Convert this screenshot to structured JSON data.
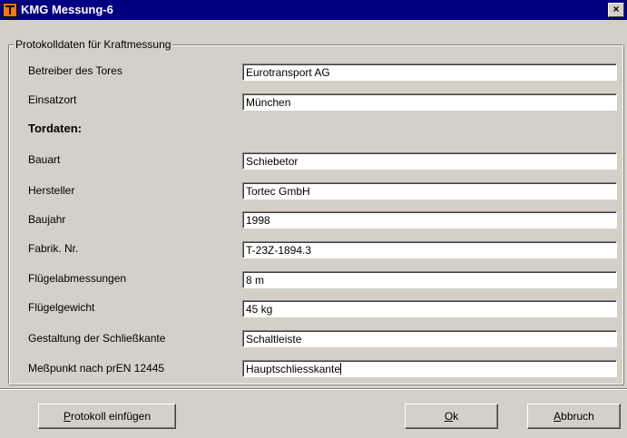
{
  "window": {
    "title": "KMG Messung-6",
    "close_glyph": "×",
    "icon": "app-icon"
  },
  "group": {
    "legend": "Protokolldaten für Kraftmessung",
    "section_heading": "Tordaten:"
  },
  "fields": [
    {
      "label": "Betreiber des Tores",
      "value": "Eurotransport AG"
    },
    {
      "label": "Einsatzort",
      "value": "München"
    },
    {
      "label": "Bauart",
      "value": "Schiebetor"
    },
    {
      "label": "Hersteller",
      "value": "Tortec GmbH"
    },
    {
      "label": "Baujahr",
      "value": "1998"
    },
    {
      "label": "Fabrik. Nr.",
      "value": "T-23Z-1894.3"
    },
    {
      "label": "Flügelabmessungen",
      "value": "8 m"
    },
    {
      "label": "Flügelgewicht",
      "value": "45 kg"
    },
    {
      "label": "Gestaltung der Schließkante",
      "value": "Schaltleiste"
    },
    {
      "label": "Meßpunkt nach prEN 12445",
      "value": "Hauptschliesskante"
    }
  ],
  "buttons": {
    "insert_protocol": {
      "mnemonic": "P",
      "rest": "rotokoll einfügen"
    },
    "ok": {
      "mnemonic": "O",
      "rest": "k"
    },
    "cancel": {
      "mnemonic": "A",
      "rest": "bbruch"
    }
  }
}
